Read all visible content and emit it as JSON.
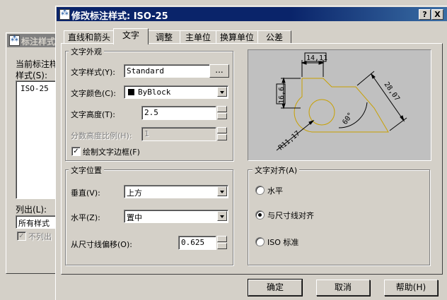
{
  "background_dialog": {
    "title": "标注样式",
    "current_style_label": "当前标注样",
    "styles_label": "样式(S):",
    "styles": [
      "ISO-25"
    ],
    "list_label": "列出(L):",
    "list_value": "所有样式",
    "dont_list_label": "不列出"
  },
  "dialog": {
    "title": "修改标注样式: ISO-25",
    "help_caption": "?",
    "close_caption": "X",
    "tabs": [
      {
        "label": "直线和箭头"
      },
      {
        "label": "文字"
      },
      {
        "label": "调整"
      },
      {
        "label": "主单位"
      },
      {
        "label": "换算单位"
      },
      {
        "label": "公差"
      }
    ],
    "active_tab": "文字"
  },
  "text_appearance": {
    "group_label": "文字外观",
    "style_label": "文字样式(Y):",
    "style_value": "Standard",
    "browse_label": "...",
    "color_label": "文字颜色(C):",
    "color_value": "ByBlock",
    "height_label": "文字高度(T):",
    "height_value": "2.5",
    "fraction_label": "分数高度比例(H):",
    "fraction_value": "1",
    "frame_label": "绘制文字边框(F)",
    "frame_checked": true
  },
  "text_placement": {
    "group_label": "文字位置",
    "vertical_label": "垂直(V):",
    "vertical_value": "上方",
    "horizontal_label": "水平(Z):",
    "horizontal_value": "置中",
    "offset_label": "从尺寸线偏移(O):",
    "offset_value": "0.625"
  },
  "text_alignment": {
    "group_label": "文字对齐(A)",
    "options": [
      {
        "label": "水平",
        "selected": false
      },
      {
        "label": "与尺寸线对齐",
        "selected": true
      },
      {
        "label": "ISO 标准",
        "selected": false
      }
    ]
  },
  "preview": {
    "dim_top": "14,11",
    "dim_left": "16,6",
    "dim_right": "28,07",
    "dim_angle": "60°",
    "dim_radius": "R11,17",
    "line_color": "#c8a000",
    "dim_color": "#000000"
  },
  "buttons": {
    "ok": "确定",
    "cancel": "取消",
    "help": "帮助(H)"
  }
}
